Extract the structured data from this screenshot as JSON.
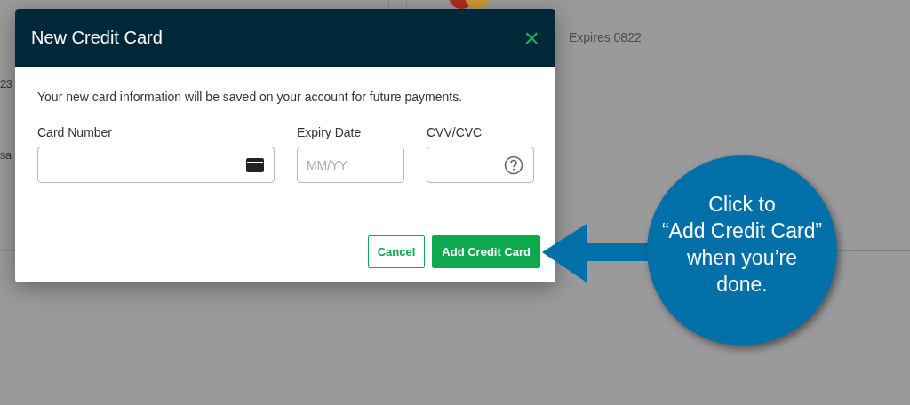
{
  "background_page": {
    "fragment_1": "23",
    "fragment_2": "sa",
    "card_expiry": "Expires 0822"
  },
  "dialog": {
    "title": "New Credit Card",
    "close": "×",
    "description": "Your new card information will be saved on your account for future payments.",
    "fields": [
      {
        "kind": "card",
        "label": "Card Number"
      },
      {
        "kind": "plain",
        "label": "Expiry Date",
        "placeholder": "MM/YY"
      },
      {
        "kind": "help",
        "label": "CVV/CVC"
      }
    ],
    "buttons": [
      {
        "kind": "secondary",
        "label": "Cancel"
      },
      {
        "kind": "primary",
        "label": "Add Credit Card"
      }
    ]
  },
  "callout": {
    "lines": [
      "Click to",
      "“Add Credit Card”",
      "when you’re",
      "done."
    ]
  }
}
